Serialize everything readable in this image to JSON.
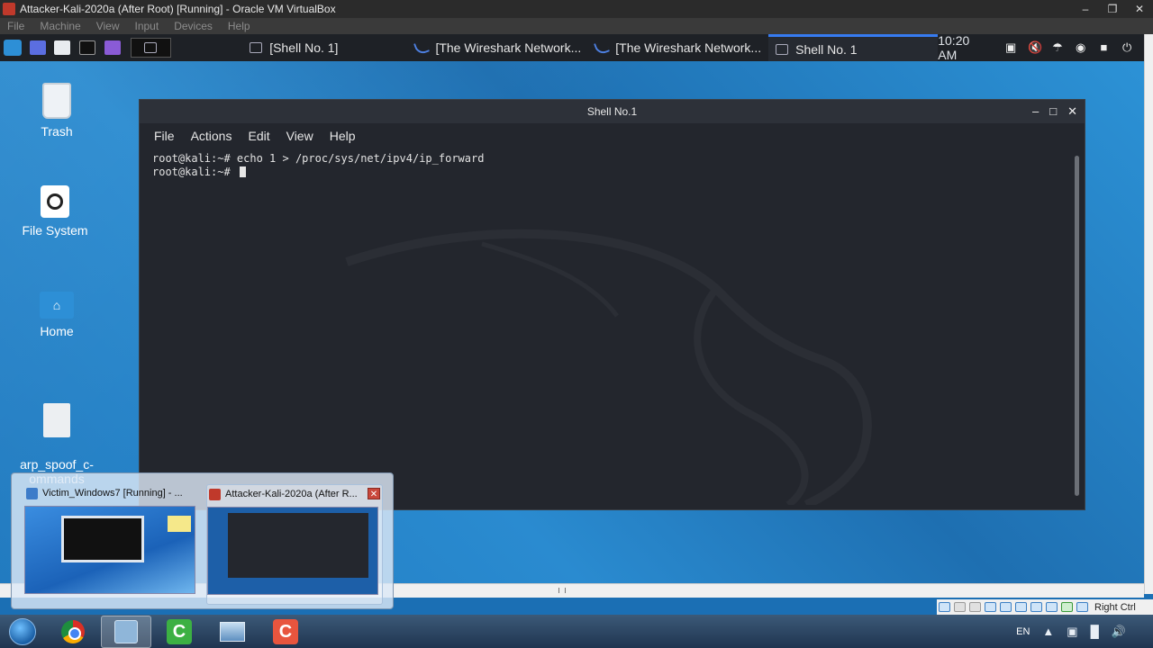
{
  "vbox": {
    "title": "Attacker-Kali-2020a (After Root) [Running] - Oracle VM VirtualBox",
    "menu": [
      "File",
      "Machine",
      "View",
      "Input",
      "Devices",
      "Help"
    ],
    "host_key": "Right Ctrl"
  },
  "panel": {
    "tasks": [
      {
        "label": "[Shell No. 1]"
      },
      {
        "label": "[The Wireshark Network..."
      },
      {
        "label": "[The Wireshark Network..."
      },
      {
        "label": "Shell No. 1"
      }
    ],
    "clock": "10:20 AM"
  },
  "desktop": {
    "icons": [
      {
        "label": "Trash"
      },
      {
        "label": "File System"
      },
      {
        "label": "Home"
      },
      {
        "label": "arp_spoof_c-\nommands"
      }
    ]
  },
  "terminal": {
    "title": "Shell No.1",
    "menu": [
      "File",
      "Actions",
      "Edit",
      "View",
      "Help"
    ],
    "lines": [
      "root@kali:~# echo 1 > /proc/sys/net/ipv4/ip_forward",
      "root@kali:~# "
    ]
  },
  "preview": {
    "items": [
      {
        "title": "Victim_Windows7 [Running] - ..."
      },
      {
        "title": "Attacker-Kali-2020a (After R..."
      }
    ]
  },
  "taskbar": {
    "lang": "EN"
  }
}
